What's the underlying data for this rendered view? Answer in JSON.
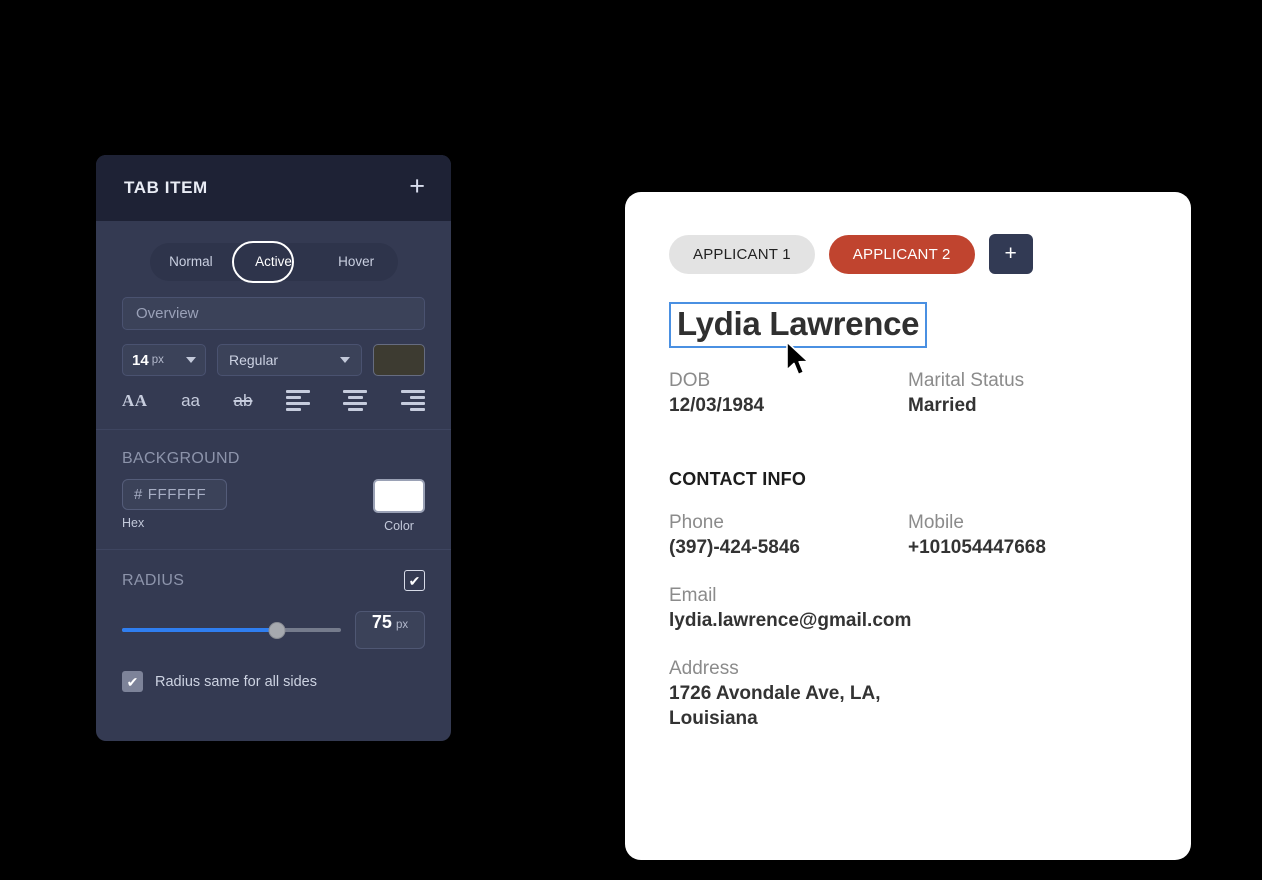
{
  "panel": {
    "title": "TAB ITEM",
    "add_icon": "plus-icon",
    "add_label": "+",
    "states": {
      "options": [
        "Normal",
        "Active",
        "Hover"
      ],
      "selected": "Active"
    },
    "text_input": {
      "value": "Overview",
      "placeholder": "Overview"
    },
    "font": {
      "size_value": "14",
      "size_unit": "px",
      "weight": "Regular",
      "color_swatch": "#3d3b31"
    },
    "style_icons": [
      {
        "name": "uppercase-icon",
        "glyph": "AA"
      },
      {
        "name": "lowercase-icon",
        "glyph": "aa"
      },
      {
        "name": "strikethrough-icon",
        "glyph": "ab"
      },
      {
        "name": "align-left-icon",
        "glyph": ""
      },
      {
        "name": "align-center-icon",
        "glyph": ""
      },
      {
        "name": "align-right-icon",
        "glyph": ""
      }
    ],
    "background": {
      "heading": "BACKGROUND",
      "hex_value": "# FFFFFF",
      "hex_label": "Hex",
      "color_label": "Color",
      "color_swatch": "#ffffff"
    },
    "radius": {
      "heading": "RADIUS",
      "enabled": true,
      "value": "75",
      "unit": "px",
      "percent": 71,
      "fill_color": "#2f7ef0",
      "same_all_sides_label": "Radius same for all sides",
      "same_all_sides_checked": true
    }
  },
  "card": {
    "tabs": [
      {
        "label": "APPLICANT 1",
        "active": false
      },
      {
        "label": "APPLICANT 2",
        "active": true
      }
    ],
    "add_tab_label": "+",
    "accent_color": "#c0442f",
    "selected_name": "Lydia Lawrence",
    "selection_color": "#4a90e2",
    "fields": {
      "dob_label": "DOB",
      "dob_value": "12/03/1984",
      "marital_label": "Marital Status",
      "marital_value": "Married"
    },
    "contact": {
      "heading": "CONTACT INFO",
      "phone_label": "Phone",
      "phone_value": "(397)-424-5846",
      "mobile_label": "Mobile",
      "mobile_value": "+101054447668",
      "email_label": "Email",
      "email_value": "lydia.lawrence@gmail.com",
      "address_label": "Address",
      "address_line1": "1726 Avondale Ave, LA,",
      "address_line2": "Louisiana"
    }
  }
}
